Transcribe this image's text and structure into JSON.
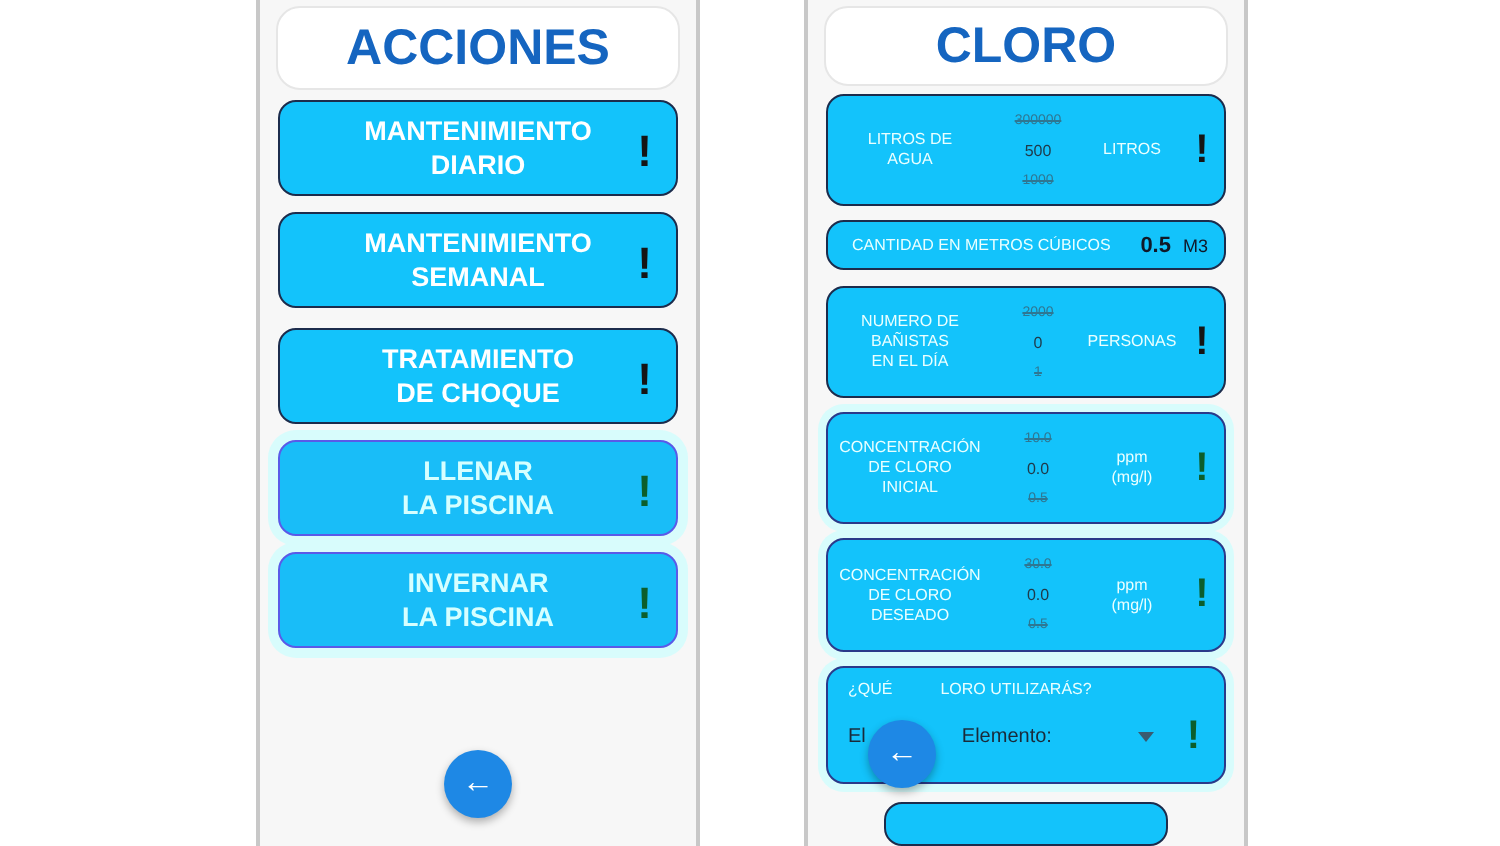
{
  "acciones": {
    "title": "ACCIONES",
    "buttons": [
      {
        "label": "MANTENIMIENTO\nDIARIO",
        "mark": "!",
        "highlighted": false
      },
      {
        "label": "MANTENIMIENTO\nSEMANAL",
        "mark": "!",
        "highlighted": false
      },
      {
        "label": "TRATAMIENTO\nDE CHOQUE",
        "mark": "!",
        "highlighted": false
      },
      {
        "label": "LLENAR\nLA PISCINA",
        "mark": "!",
        "highlighted": true
      },
      {
        "label": "INVERNAR\nLA PISCINA",
        "mark": "!",
        "highlighted": true
      }
    ],
    "back_button": "←"
  },
  "cloro": {
    "title": "CLORO",
    "cards": [
      {
        "kind": "picker",
        "label": "LITROS DE\nAGUA",
        "above": "300000",
        "value": "500",
        "below": "1000",
        "unit": "LITROS",
        "mark": "!",
        "highlighted": false
      },
      {
        "kind": "result",
        "label": "CANTIDAD EN METROS CÚBICOS",
        "value": "0.5",
        "unit": "M3"
      },
      {
        "kind": "picker",
        "label": "NUMERO DE\nBAÑISTAS\nEN EL DÍA",
        "above": "2000",
        "value": "0",
        "below": "1",
        "unit": "PERSONAS",
        "mark": "!",
        "highlighted": false
      },
      {
        "kind": "picker",
        "label": "CONCENTRACIÓN\nDE CLORO\nINICIAL",
        "above": "10.0",
        "value": "0.0",
        "below": "0.5",
        "unit": "ppm\n(mg/l)",
        "mark": "!",
        "highlighted": true
      },
      {
        "kind": "picker",
        "label": "CONCENTRACIÓN\nDE CLORO\nDESEADO",
        "above": "30.0",
        "value": "0.0",
        "below": "0.5",
        "unit": "ppm\n(mg/l)",
        "mark": "!",
        "highlighted": true
      },
      {
        "kind": "select",
        "label_parts": [
          "¿QUÉ",
          "LORO UTILIZARÁS?"
        ],
        "value_parts": [
          "El",
          "Elemento:"
        ],
        "mark": "!",
        "highlighted": true
      }
    ],
    "back_button": "←"
  }
}
